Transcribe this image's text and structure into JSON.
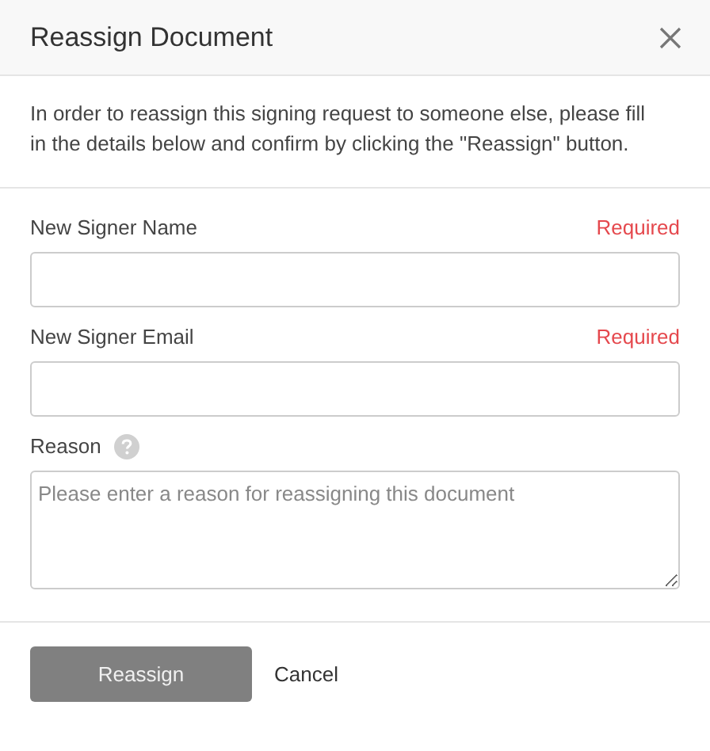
{
  "dialog": {
    "title": "Reassign Document",
    "intro": "In order to reassign this signing request to someone else, please fill in the details below and confirm by clicking the \"Reassign\" button."
  },
  "fields": [
    {
      "kind": "input",
      "label": "New Signer Name",
      "required_note": "Required"
    },
    {
      "kind": "input",
      "label": "New Signer Email",
      "required_note": "Required"
    },
    {
      "kind": "textarea",
      "label": "Reason",
      "help": true,
      "placeholder": "Please enter a reason for reassigning this document"
    }
  ],
  "buttons": {
    "primary": {
      "label": "Reassign",
      "disabled": true
    },
    "secondary": {
      "label": "Cancel"
    }
  }
}
